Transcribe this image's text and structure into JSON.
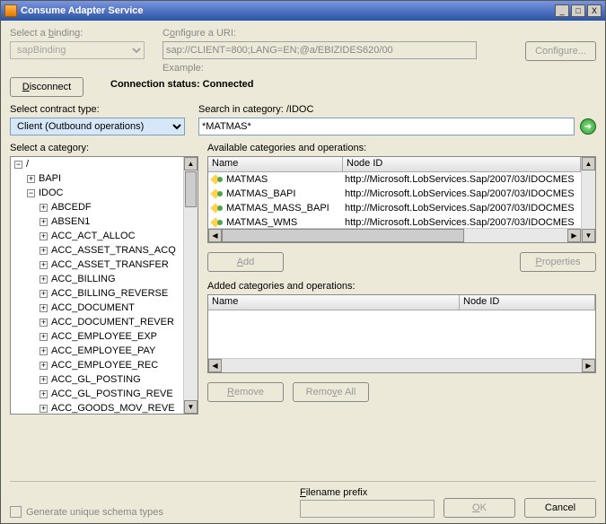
{
  "window": {
    "title": "Consume Adapter Service"
  },
  "binding": {
    "label_pre": "Select a ",
    "label_u": "b",
    "label_post": "inding:",
    "value": "sapBinding",
    "uri_label_pre": "C",
    "uri_label_u": "o",
    "uri_label_post": "nfigure a URI:",
    "uri_value": "sap://CLIENT=800;LANG=EN;@a/EBIZIDES620/00",
    "example_label": "Example:",
    "configure_btn_pre": "Confi",
    "configure_btn_u": "g",
    "configure_btn_post": "ure...",
    "disconnect_pre": "",
    "disconnect_u": "D",
    "disconnect_post": "isconnect"
  },
  "status": {
    "prefix": "Connection status: ",
    "value": "Connected"
  },
  "contract": {
    "label": "Select contract type:",
    "value": "Client (Outbound operations)",
    "search_label": "Search in category: /IDOC",
    "search_value": "*MATMAS*"
  },
  "category": {
    "label": "Select a category:",
    "root": "/",
    "bapi": "BAPI",
    "idoc": "IDOC",
    "items": [
      "ABCEDF",
      "ABSEN1",
      "ACC_ACT_ALLOC",
      "ACC_ASSET_TRANS_ACQ",
      "ACC_ASSET_TRANSFER",
      "ACC_BILLING",
      "ACC_BILLING_REVERSE",
      "ACC_DOCUMENT",
      "ACC_DOCUMENT_REVER",
      "ACC_EMPLOYEE_EXP",
      "ACC_EMPLOYEE_PAY",
      "ACC_EMPLOYEE_REC",
      "ACC_GL_POSTING",
      "ACC_GL_POSTING_REVE",
      "ACC_GOODS_MOV_REVE"
    ]
  },
  "available": {
    "label": "Available categories and operations:",
    "col1": "Name",
    "col2": "Node ID",
    "rows": [
      {
        "name": "MATMAS",
        "node": "http://Microsoft.LobServices.Sap/2007/03/IDOCMES"
      },
      {
        "name": "MATMAS_BAPI",
        "node": "http://Microsoft.LobServices.Sap/2007/03/IDOCMES"
      },
      {
        "name": "MATMAS_MASS_BAPI",
        "node": "http://Microsoft.LobServices.Sap/2007/03/IDOCMES"
      },
      {
        "name": "MATMAS_WMS",
        "node": "http://Microsoft.LobServices.Sap/2007/03/IDOCMES"
      }
    ],
    "add_u": "A",
    "add_post": "dd",
    "props_pre": "",
    "props_u": "P",
    "props_post": "roperties"
  },
  "added": {
    "label": "Added categories and operations:",
    "col1": "Name",
    "col2": "Node ID",
    "remove_pre": "",
    "remove_u": "R",
    "remove_post": "emove",
    "removeall_pre": "Remo",
    "removeall_u": "v",
    "removeall_post": "e All"
  },
  "footer": {
    "gen_label": "Generate unique schema types",
    "filename_label_pre": "",
    "filename_label_u": "F",
    "filename_label_post": "ilename prefix",
    "ok": "OK",
    "ok_u": "O",
    "ok_post": "K",
    "cancel": "Cancel"
  }
}
